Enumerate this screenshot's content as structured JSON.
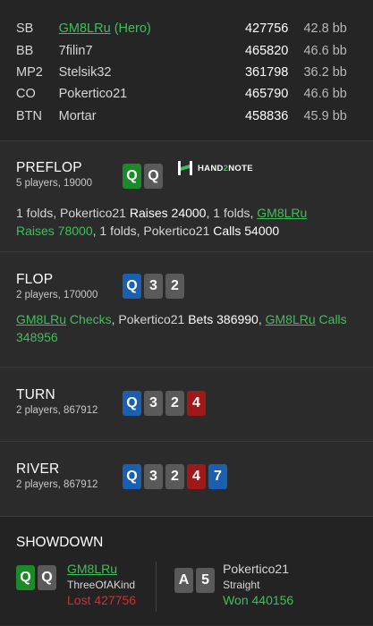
{
  "players": [
    {
      "pos": "SB",
      "name": "GM8LRu",
      "tag": "(Hero)",
      "stack": "427756",
      "bb": "42.8 bb"
    },
    {
      "pos": "BB",
      "name": "7filin7",
      "tag": "",
      "stack": "465820",
      "bb": "46.6 bb"
    },
    {
      "pos": "MP2",
      "name": "Stelsik32",
      "tag": "",
      "stack": "361798",
      "bb": "36.2 bb"
    },
    {
      "pos": "CO",
      "name": "Pokertico21",
      "tag": "",
      "stack": "465790",
      "bb": "46.6 bb"
    },
    {
      "pos": "BTN",
      "name": "Mortar",
      "tag": "",
      "stack": "458836",
      "bb": "45.9 bb"
    }
  ],
  "logo": {
    "text_pre": "HAND",
    "text_two": "2",
    "text_post": "NOTE"
  },
  "preflop": {
    "title": "PREFLOP",
    "sub": "5 players, 19000",
    "cards": [
      "Q",
      "Q"
    ],
    "actions": {
      "a1": "1 folds, Pokertico21 ",
      "a2": "Raises 24000",
      "a3": ", 1 folds, ",
      "a4": "GM8LRu",
      "a5": "Raises 78000",
      "a6": ", 1 folds, Pokertico21 ",
      "a7": "Calls 54000"
    }
  },
  "flop": {
    "title": "FLOP",
    "sub": "2 players, 170000",
    "cards": [
      "Q",
      "3",
      "2"
    ],
    "actions": {
      "a1": "GM8LRu",
      "a2": " Checks",
      "a3": ", Pokertico21 ",
      "a4": "Bets 386990",
      "a5": ", ",
      "a6": "GM8LRu",
      "a7": " Calls 348956"
    }
  },
  "turn": {
    "title": "TURN",
    "sub": "2 players, 867912",
    "cards": [
      "Q",
      "3",
      "2",
      "4"
    ]
  },
  "river": {
    "title": "RIVER",
    "sub": "2 players, 867912",
    "cards": [
      "Q",
      "3",
      "2",
      "4",
      "7"
    ]
  },
  "showdown": {
    "title": "SHOWDOWN",
    "hands": [
      {
        "cards": [
          "Q",
          "Q"
        ],
        "name": "GM8LRu",
        "hand": "ThreeOfAKind",
        "result": "Lost 427756"
      },
      {
        "cards": [
          "A",
          "5"
        ],
        "name": "Pokertico21",
        "hand": "Straight",
        "result": "Won 440156"
      }
    ]
  },
  "colors": {
    "green": "#3fbf5a",
    "red": "#d03030",
    "card_blue": "#1a5fb0",
    "card_red": "#a11818",
    "card_gray": "#5a5a5a",
    "card_green": "#1d8a2a"
  }
}
